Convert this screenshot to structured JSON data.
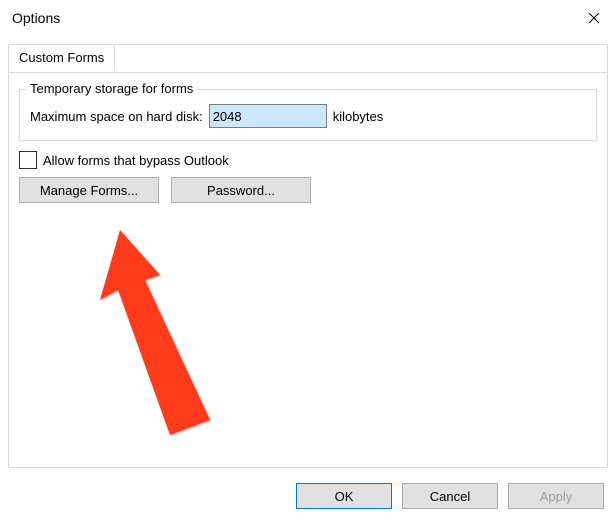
{
  "window": {
    "title": "Options"
  },
  "tab": {
    "label": "Custom Forms"
  },
  "group": {
    "title": "Temporary storage for forms",
    "maxspace_label": "Maximum space on hard disk:",
    "maxspace_value": "2048",
    "maxspace_unit": "kilobytes"
  },
  "checkbox": {
    "allow_bypass_label": "Allow forms that bypass Outlook",
    "checked": false
  },
  "buttons": {
    "manage_forms": "Manage Forms...",
    "password": "Password..."
  },
  "footer": {
    "ok": "OK",
    "cancel": "Cancel",
    "apply": "Apply"
  }
}
